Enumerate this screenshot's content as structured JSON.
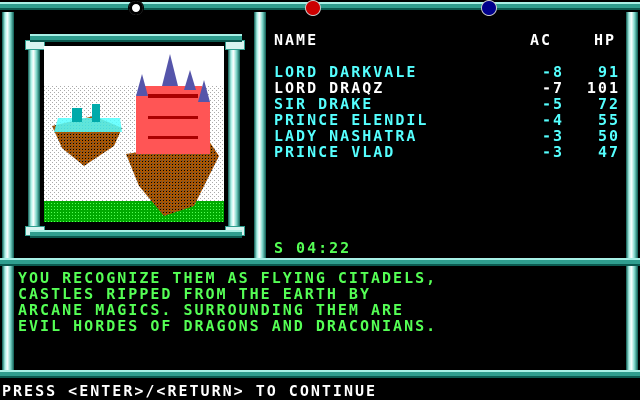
{
  "header": {
    "name": "NAME",
    "ac": "AC",
    "hp": "HP"
  },
  "party": [
    {
      "name": "LORD DARKVALE",
      "ac": "-8",
      "hp": "91",
      "color": "#55ffff"
    },
    {
      "name": "LORD DRAQZ",
      "ac": "-7",
      "hp": "101",
      "color": "#ffffff"
    },
    {
      "name": "SIR DRAKE",
      "ac": "-5",
      "hp": "72",
      "color": "#55ffff"
    },
    {
      "name": "PRINCE ELENDIL",
      "ac": "-4",
      "hp": "55",
      "color": "#55ffff"
    },
    {
      "name": "LADY NASHATRA",
      "ac": "-3",
      "hp": "50",
      "color": "#55ffff"
    },
    {
      "name": "PRINCE VLAD",
      "ac": "-3",
      "hp": "47",
      "color": "#55ffff"
    }
  ],
  "status": {
    "clock": "S 04:22"
  },
  "message": [
    "YOU RECOGNIZE THEM AS FLYING CITADELS,",
    "CASTLES RIPPED FROM THE EARTH BY",
    "ARCANE MAGICS. SURROUNDING THEM ARE",
    "EVIL HORDES OF DRAGONS AND DRACONIANS."
  ],
  "prompt": "PRESS <ENTER>/<RETURN> TO CONTINUE",
  "colors": {
    "frame": "#2f9e8f",
    "name_text": "#55ffff",
    "message_text": "#55ff55",
    "gem_left": "#ffffff",
    "gem_mid": "#cc0000",
    "gem_right": "#00008b"
  }
}
